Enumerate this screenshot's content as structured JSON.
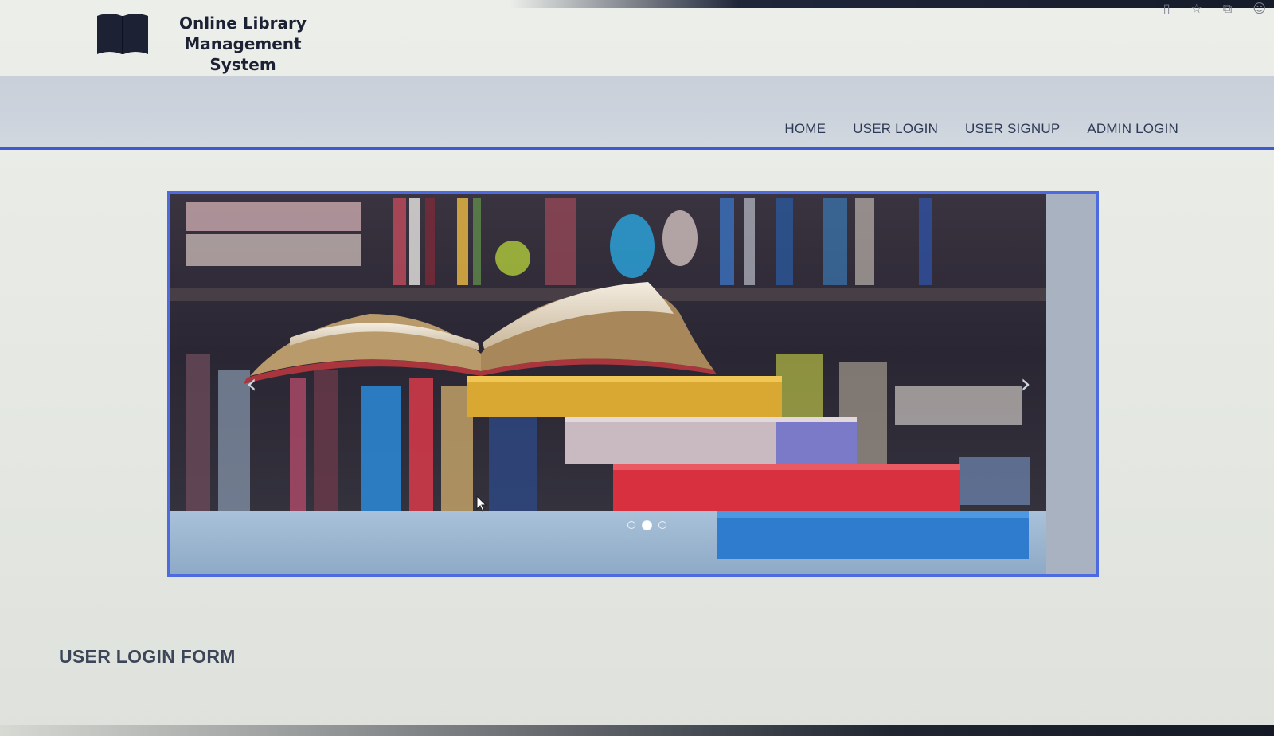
{
  "header": {
    "logo_icon": "book-icon",
    "title_line1": "Online Library",
    "title_line2": "Management System"
  },
  "nav": {
    "items": [
      {
        "label": "HOME"
      },
      {
        "label": "USER LOGIN"
      },
      {
        "label": "USER SIGNUP"
      },
      {
        "label": "ADMIN LOGIN"
      }
    ]
  },
  "carousel": {
    "prev_icon": "chevron-left-icon",
    "next_icon": "chevron-right-icon",
    "prev_glyph": "‹",
    "next_glyph": "›",
    "slide_count": 3,
    "active_index": 1,
    "slide_image": "books-stack-photo"
  },
  "main": {
    "form_title": "USER LOGIN FORM"
  },
  "colors": {
    "accent": "#3f5ad0",
    "nav_text": "#2d3a55",
    "logo_text": "#1c2133"
  }
}
